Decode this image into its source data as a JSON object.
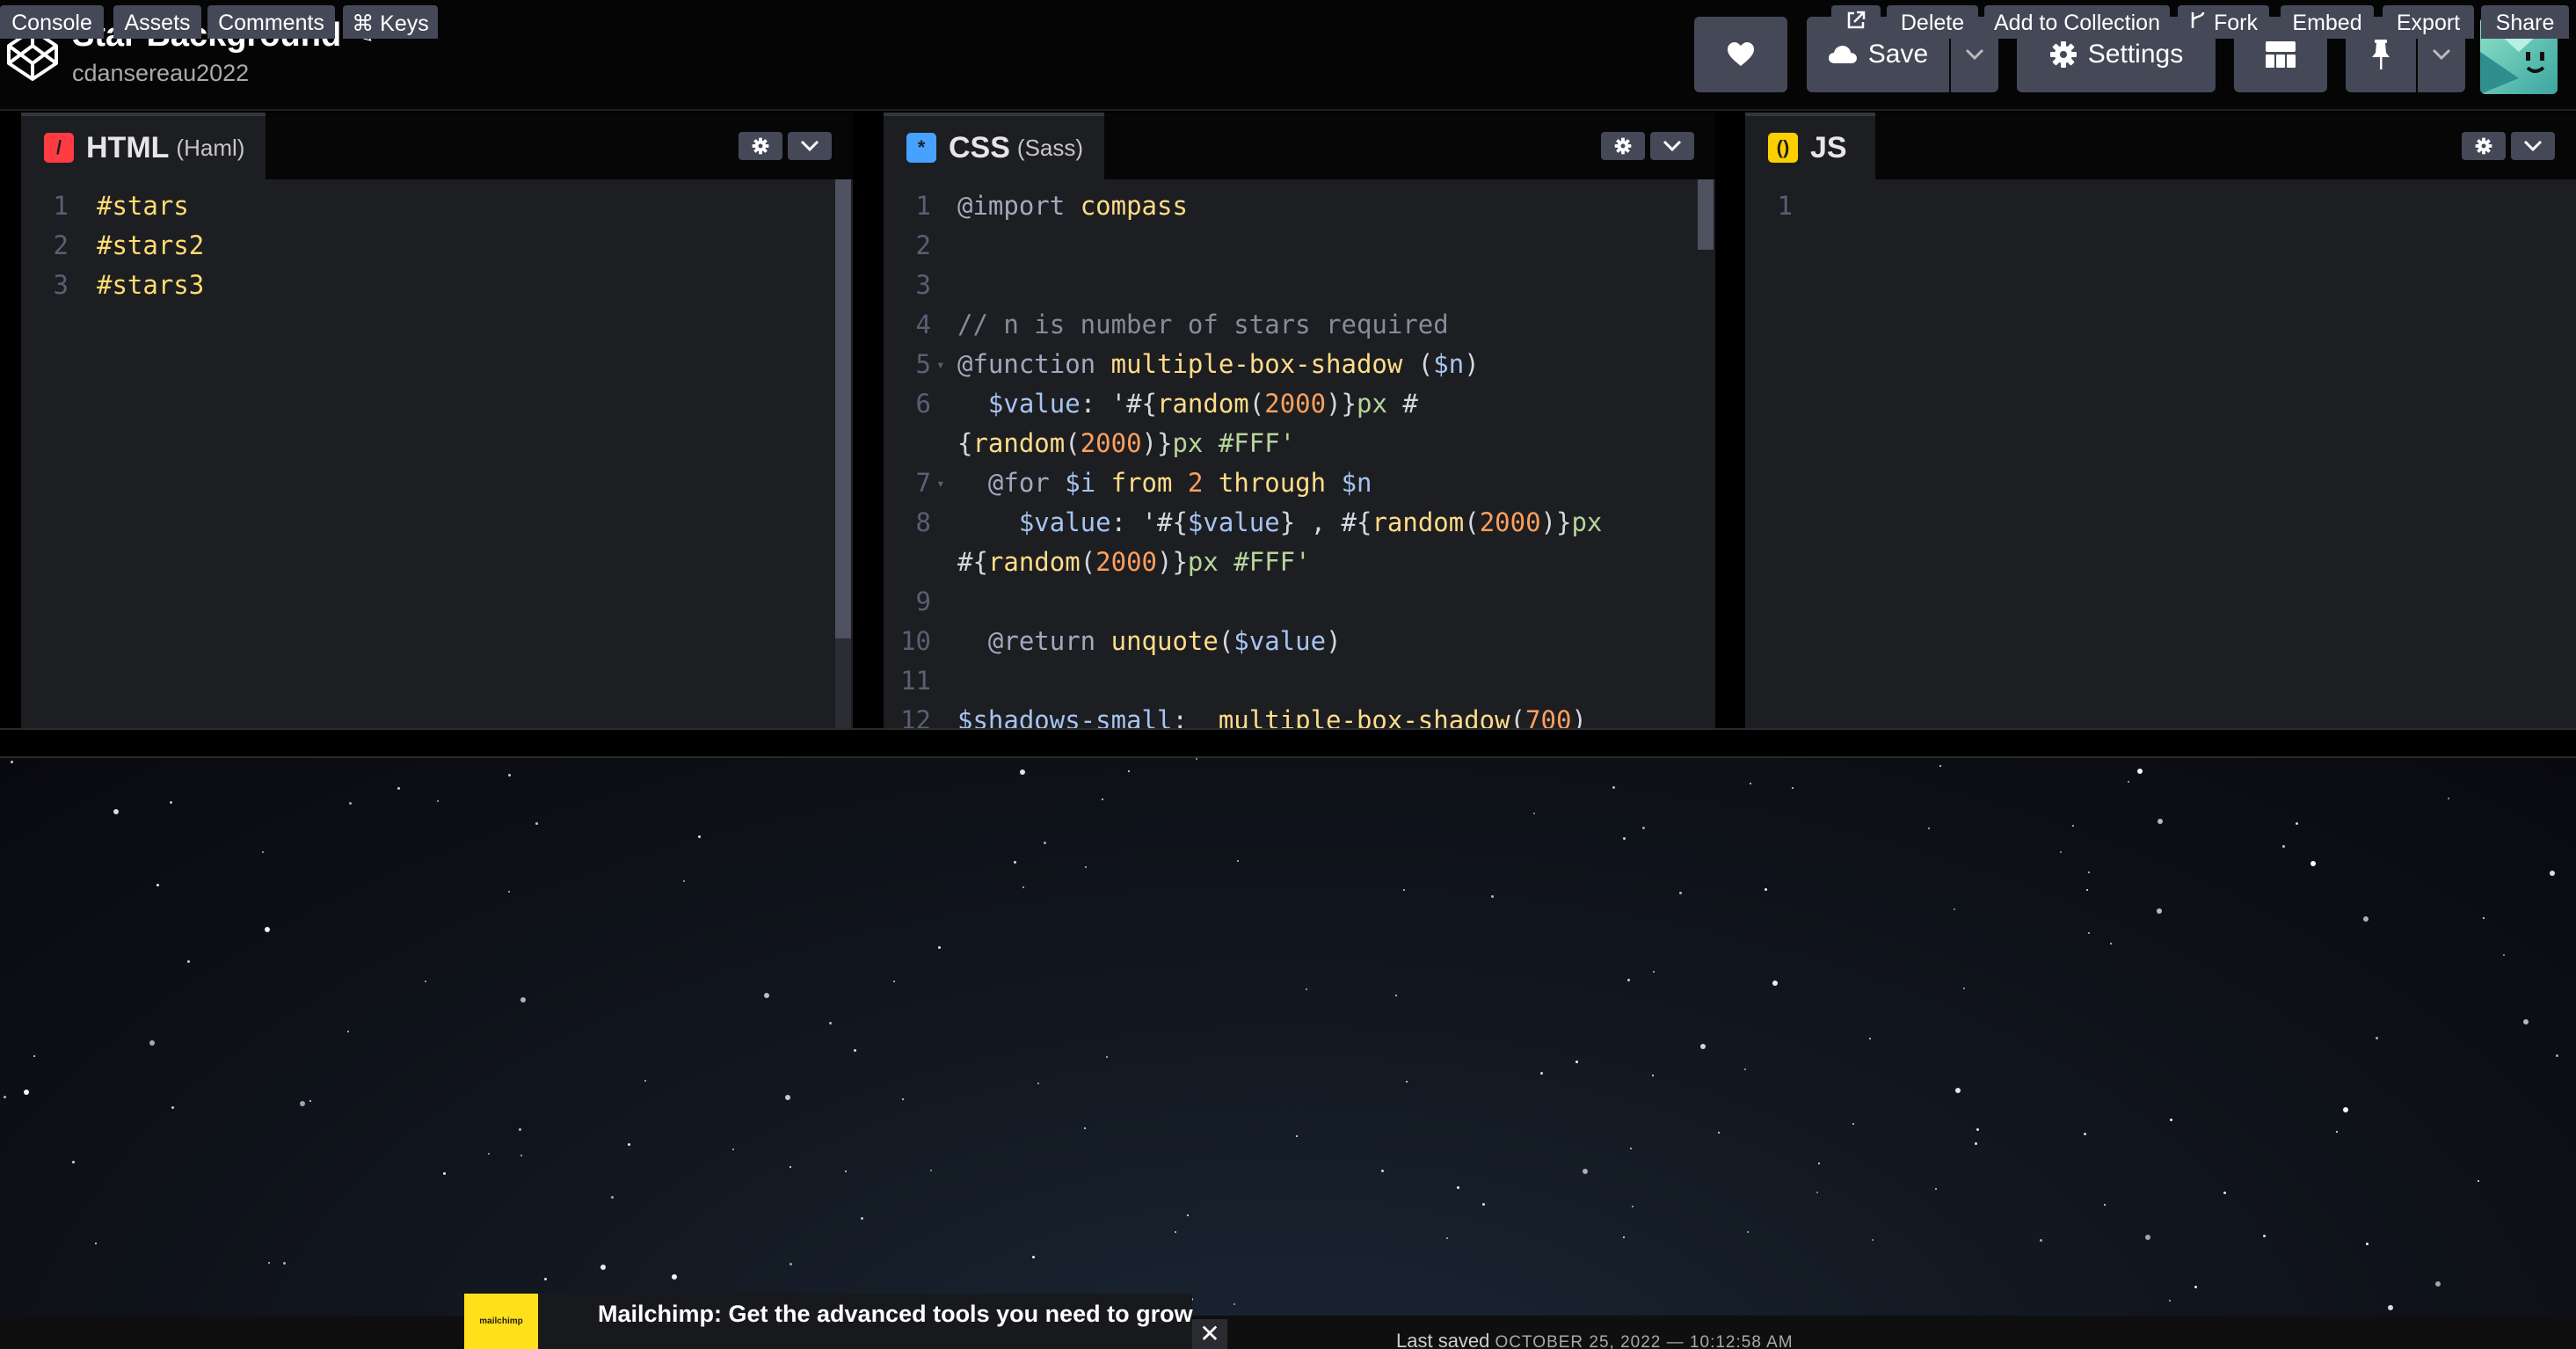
{
  "header": {
    "title": "Star Background",
    "user": "cdansereau2022",
    "save_label": "Save",
    "settings_label": "Settings"
  },
  "editors": {
    "html": {
      "name": "HTML",
      "preprocessor": "(Haml)",
      "lines": [
        {
          "n": "1",
          "tokens": [
            {
              "t": "#stars",
              "c": "sel"
            }
          ]
        },
        {
          "n": "2",
          "tokens": [
            {
              "t": "#stars2",
              "c": "sel"
            }
          ]
        },
        {
          "n": "3",
          "tokens": [
            {
              "t": "#stars3",
              "c": "sel"
            }
          ]
        }
      ]
    },
    "css": {
      "name": "CSS",
      "preprocessor": "(Sass)",
      "lines": [
        {
          "n": "1",
          "tokens": [
            {
              "t": "@import",
              "c": "kw"
            },
            {
              "t": " ",
              "c": "val"
            },
            {
              "t": "compass",
              "c": "fn"
            }
          ]
        },
        {
          "n": "2",
          "tokens": []
        },
        {
          "n": "3",
          "tokens": []
        },
        {
          "n": "4",
          "tokens": [
            {
              "t": "// n is number of stars required",
              "c": "com"
            }
          ]
        },
        {
          "n": "5",
          "fold": true,
          "tokens": [
            {
              "t": "@function",
              "c": "kw"
            },
            {
              "t": " ",
              "c": "val"
            },
            {
              "t": "multiple-box-shadow",
              "c": "fn"
            },
            {
              "t": " (",
              "c": "val"
            },
            {
              "t": "$n",
              "c": "var"
            },
            {
              "t": ")",
              "c": "val"
            }
          ]
        },
        {
          "n": "6",
          "tokens": [
            {
              "t": "  ",
              "c": "val"
            },
            {
              "t": "$value",
              "c": "var"
            },
            {
              "t": ": '#{",
              "c": "val"
            },
            {
              "t": "random",
              "c": "fn"
            },
            {
              "t": "(",
              "c": "val"
            },
            {
              "t": "2000",
              "c": "num"
            },
            {
              "t": ")}",
              "c": "val"
            },
            {
              "t": "px",
              "c": "str"
            },
            {
              "t": " #",
              "c": "val"
            }
          ]
        },
        {
          "n": "",
          "tokens": [
            {
              "t": "{",
              "c": "val"
            },
            {
              "t": "random",
              "c": "fn"
            },
            {
              "t": "(",
              "c": "val"
            },
            {
              "t": "2000",
              "c": "num"
            },
            {
              "t": ")}",
              "c": "val"
            },
            {
              "t": "px #FFF'",
              "c": "str"
            }
          ]
        },
        {
          "n": "7",
          "fold": true,
          "tokens": [
            {
              "t": "  ",
              "c": "val"
            },
            {
              "t": "@for",
              "c": "kw"
            },
            {
              "t": " ",
              "c": "val"
            },
            {
              "t": "$i",
              "c": "var"
            },
            {
              "t": " ",
              "c": "val"
            },
            {
              "t": "from",
              "c": "fn"
            },
            {
              "t": " ",
              "c": "val"
            },
            {
              "t": "2",
              "c": "num"
            },
            {
              "t": " ",
              "c": "val"
            },
            {
              "t": "through",
              "c": "fn"
            },
            {
              "t": " ",
              "c": "val"
            },
            {
              "t": "$n",
              "c": "var"
            }
          ]
        },
        {
          "n": "8",
          "tokens": [
            {
              "t": "    ",
              "c": "val"
            },
            {
              "t": "$value",
              "c": "var"
            },
            {
              "t": ": '#{",
              "c": "val"
            },
            {
              "t": "$value",
              "c": "var"
            },
            {
              "t": "} , #{",
              "c": "val"
            },
            {
              "t": "random",
              "c": "fn"
            },
            {
              "t": "(",
              "c": "val"
            },
            {
              "t": "2000",
              "c": "num"
            },
            {
              "t": ")}",
              "c": "val"
            },
            {
              "t": "px",
              "c": "str"
            }
          ]
        },
        {
          "n": "",
          "tokens": [
            {
              "t": "#{",
              "c": "val"
            },
            {
              "t": "random",
              "c": "fn"
            },
            {
              "t": "(",
              "c": "val"
            },
            {
              "t": "2000",
              "c": "num"
            },
            {
              "t": ")}",
              "c": "val"
            },
            {
              "t": "px #FFF'",
              "c": "str"
            }
          ]
        },
        {
          "n": "9",
          "tokens": []
        },
        {
          "n": "10",
          "tokens": [
            {
              "t": "  ",
              "c": "val"
            },
            {
              "t": "@return",
              "c": "kw"
            },
            {
              "t": " ",
              "c": "val"
            },
            {
              "t": "unquote",
              "c": "fn"
            },
            {
              "t": "(",
              "c": "val"
            },
            {
              "t": "$value",
              "c": "var"
            },
            {
              "t": ")",
              "c": "val"
            }
          ]
        },
        {
          "n": "11",
          "tokens": []
        },
        {
          "n": "12",
          "tokens": [
            {
              "t": "$shadows-small",
              "c": "var"
            },
            {
              "t": ":  ",
              "c": "val"
            },
            {
              "t": "multiple-box-shadow",
              "c": "fn"
            },
            {
              "t": "(",
              "c": "val"
            },
            {
              "t": "700",
              "c": "num"
            },
            {
              "t": ")",
              "c": "val"
            }
          ]
        }
      ]
    },
    "js": {
      "name": "JS",
      "preprocessor": "",
      "lines": [
        {
          "n": "1",
          "tokens": []
        }
      ]
    }
  },
  "footer": {
    "console": "Console",
    "assets": "Assets",
    "comments": "Comments",
    "keys": "⌘ Keys",
    "ad_logo": "mailchimp",
    "ad_text": "Mailchimp: Get the advanced tools you need to grow",
    "last_saved_label": "Last saved",
    "last_saved_date": "OCTOBER 25, 2022 — 10:12:58 AM",
    "delete": "Delete",
    "add_to_collection": "Add to Collection",
    "fork": "Fork",
    "embed": "Embed",
    "export": "Export",
    "share": "Share"
  },
  "colors": {
    "button_bg": "#444857",
    "html_icon": "#ff3c41",
    "css_icon": "#47cf73",
    "js_icon": "#fcd000"
  },
  "icons": [
    "codepen-logo-icon",
    "pencil-icon",
    "heart-icon",
    "cloud-icon",
    "chevron-down-icon",
    "gear-icon",
    "layout-icon",
    "pin-icon",
    "external-link-icon",
    "fork-icon",
    "close-icon"
  ]
}
